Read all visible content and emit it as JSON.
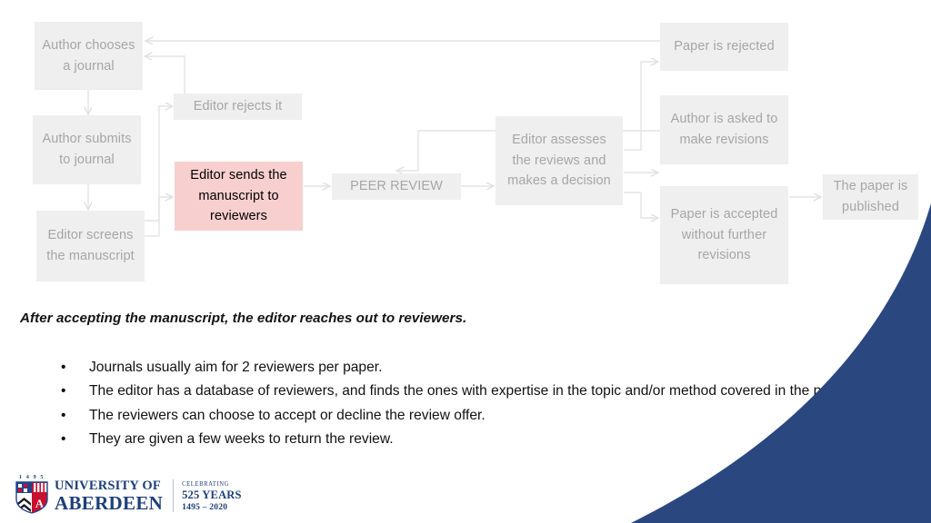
{
  "slide": {
    "background_color": "#ffffff",
    "accent_color": "#2a4780",
    "node_fill": "#efefef",
    "node_text_color": "#a6a6a6",
    "highlight_fill": "#f8cfcf",
    "highlight_text_color": "#000000",
    "connector_color": "#e4e4e4"
  },
  "flowchart": {
    "nodes": [
      {
        "id": "author-chooses-journal",
        "label": "Author chooses a journal"
      },
      {
        "id": "author-submits-journal",
        "label": "Author submits to journal"
      },
      {
        "id": "editor-screens-manuscript",
        "label": "Editor screens the manuscript"
      },
      {
        "id": "editor-rejects-it",
        "label": "Editor rejects it"
      },
      {
        "id": "editor-sends-manuscript",
        "label": "Editor sends the manuscript to reviewers"
      },
      {
        "id": "peer-review",
        "label": "PEER REVIEW"
      },
      {
        "id": "editor-assesses-reviews",
        "label": "Editor assesses the reviews and makes a decision"
      },
      {
        "id": "paper-rejected",
        "label": "Paper is rejected"
      },
      {
        "id": "author-asked-revisions",
        "label": "Author is asked to make revisions"
      },
      {
        "id": "paper-accepted",
        "label": "Paper is accepted without further revisions"
      },
      {
        "id": "paper-published",
        "label": "The paper is published"
      }
    ]
  },
  "body": {
    "lead": "After accepting the manuscript, the editor reaches out to reviewers.",
    "bullet_marker": "•",
    "bullets": [
      "Journals usually aim for 2 reviewers per paper.",
      "The editor has a database of reviewers, and finds the ones with expertise in the topic and/or method covered in the paper.",
      "The reviewers can choose to accept or decline the review offer.",
      "They are given a few weeks to return the review."
    ]
  },
  "logo": {
    "crest_year": "1 4 9 5",
    "wordmark_line1": "UNIVERSITY OF",
    "wordmark_line2": "ABERDEEN",
    "celebrating_label": "CELEBRATING",
    "celebrating_years": "525 YEARS",
    "celebrating_range": "1495 – 2020"
  }
}
